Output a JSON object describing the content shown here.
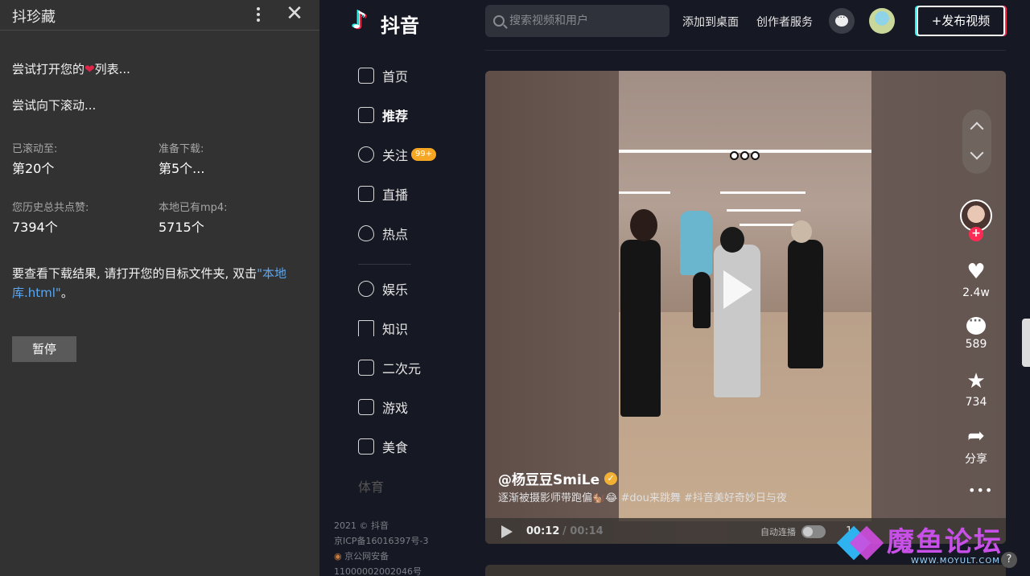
{
  "extension": {
    "title": "抖珍藏",
    "line1_pre": "尝试打开您的",
    "line1_post": "列表...",
    "line2": "尝试向下滚动...",
    "scrolled_label": "已滚动至:",
    "scrolled_value": "第20个",
    "prepare_label": "准备下载:",
    "prepare_value": "第5个...",
    "likes_label": "您历史总共点赞:",
    "likes_value": "7394个",
    "local_label": "本地已有mp4:",
    "local_value": "5715个",
    "note_pre": "要查看下载结果, 请打开您的目标文件夹, 双击",
    "note_link": "\"本地库.html\"",
    "note_post": "。",
    "pause_label": "暂停"
  },
  "nav": {
    "logo_text": "抖音",
    "items": [
      {
        "label": "首页"
      },
      {
        "label": "推荐"
      },
      {
        "label": "关注",
        "badge": "99+"
      },
      {
        "label": "直播"
      },
      {
        "label": "热点"
      },
      {
        "label": "娱乐"
      },
      {
        "label": "知识"
      },
      {
        "label": "二次元"
      },
      {
        "label": "游戏"
      },
      {
        "label": "美食"
      },
      {
        "label": "体育"
      }
    ],
    "footer": [
      "2021 © 抖音",
      "京ICP备16016397号-3",
      "京公网安备",
      "11000002002046号"
    ]
  },
  "topbar": {
    "search_placeholder": "搜索视频和用户",
    "add_desktop": "添加到桌面",
    "creator_service": "创作者服务",
    "publish": "发布视频"
  },
  "video": {
    "author": "@杨豆豆SmiLe",
    "description": "逐渐被摄影师带跑偏🐿️😂 #dou来跳舞 #抖音美好奇妙日与夜",
    "likes": "2.4w",
    "comments": "589",
    "favorites": "734",
    "share": "分享",
    "time_current": "00:12",
    "time_total": "/ 00:14",
    "autoplay": "自动连播",
    "speed": "1"
  },
  "watermark": {
    "title": "魔鱼论坛",
    "url": "WWW.MOYULT.COM"
  }
}
